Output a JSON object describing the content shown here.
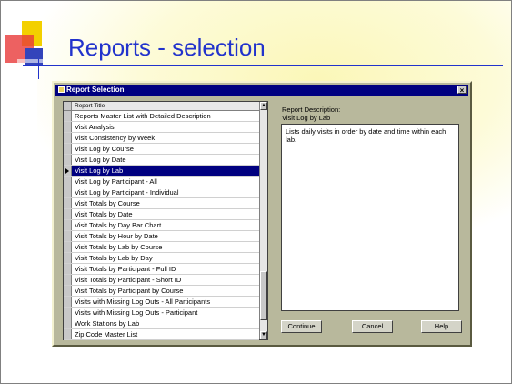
{
  "slide": {
    "title": "Reports - selection"
  },
  "dialog": {
    "title": "Report Selection",
    "close_glyph": "×",
    "list_header": "Report Title",
    "reports": [
      "Reports Master List with Detailed Description",
      "Visit Analysis",
      "Visit Consistency by Week",
      "Visit Log by Course",
      "Visit Log by Date",
      "Visit Log by Lab",
      "Visit Log by Participant - All",
      "Visit Log by Participant - Individual",
      "Visit Totals by Course",
      "Visit Totals by Date",
      "Visit Totals by Day Bar Chart",
      "Visit Totals by Hour by Date",
      "Visit Totals by Lab by Course",
      "Visit Totals by Lab by Day",
      "Visit Totals by Participant - Full ID",
      "Visit Totals by Participant - Short ID",
      "Visit Totals by Participant by Course",
      "Visits with Missing Log Outs - All Participants",
      "Visits with Missing Log Outs - Participant",
      "Work Stations by Lab",
      "Zip Code Master List"
    ],
    "selected_index": 5,
    "description_label": "Report Description:",
    "selected_title": "Visit Log by Lab",
    "description": "Lists daily visits in order by date and time within each lab.",
    "buttons": {
      "continue": "Continue",
      "cancel": "Cancel",
      "help": "Help"
    },
    "scroll_up": "▲",
    "scroll_down": "▼"
  },
  "colors": {
    "title": "#2233cc",
    "titlebar": "#000080",
    "dialog_bg": "#b8b89c",
    "selection": "#000080"
  }
}
